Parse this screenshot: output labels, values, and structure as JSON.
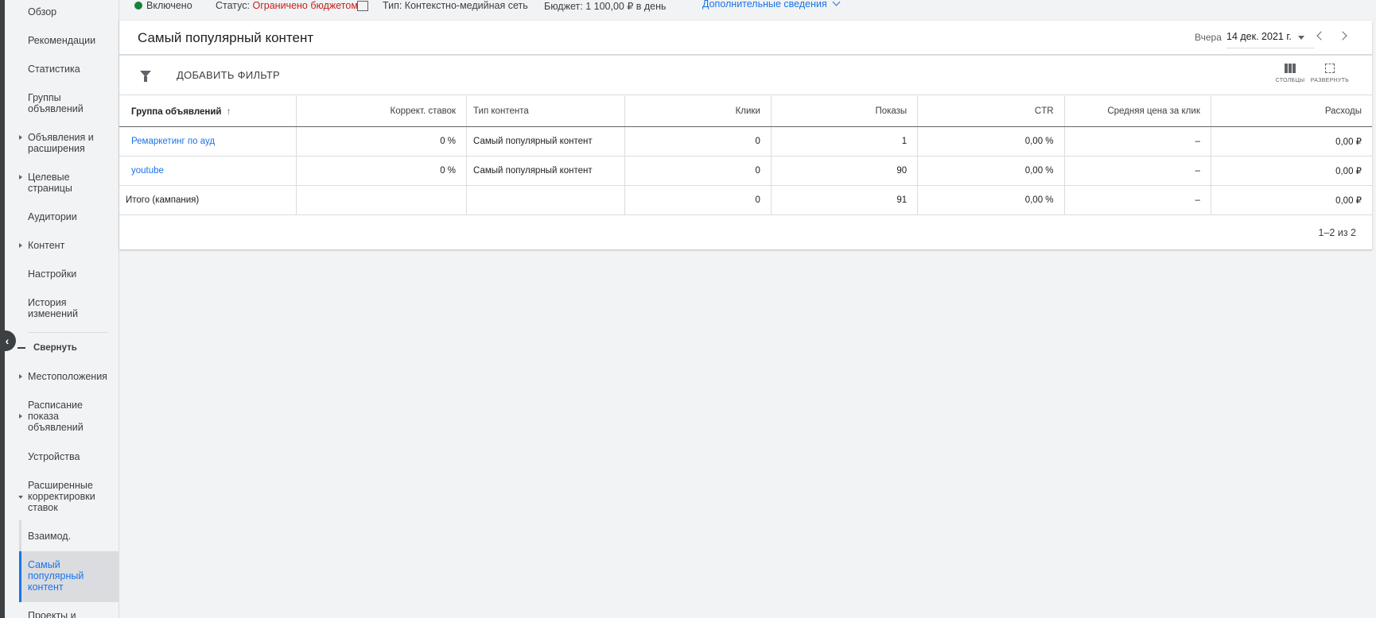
{
  "sidebar": {
    "items": [
      {
        "label": "Обзор"
      },
      {
        "label": "Рекомендации"
      },
      {
        "label": "Статистика"
      },
      {
        "label": "Группы объявлений"
      },
      {
        "label": "Объявления и расширения"
      },
      {
        "label": "Целевые страницы"
      },
      {
        "label": "Аудитории"
      },
      {
        "label": "Контент"
      },
      {
        "label": "Настройки"
      },
      {
        "label": "История изменений"
      },
      {
        "label": "Местоположения"
      },
      {
        "label": "Расписание показа объявлений"
      },
      {
        "label": "Устройства"
      },
      {
        "label": "Расширенные корректировки ставок"
      },
      {
        "label": "Взаимод."
      },
      {
        "label": "Самый популярный контент"
      },
      {
        "label": "Проекты и"
      }
    ],
    "collapse_label": "Свернуть"
  },
  "status": {
    "state": "Включено",
    "status_label": "Статус:",
    "status_value": "Ограничено бюджетом",
    "type_label": "Тип:",
    "type_value": "Контекстно-медийная сеть",
    "budget_label": "Бюджет:",
    "budget_value": "1 100,00 ₽ в день",
    "more": "Дополнительные сведения"
  },
  "card": {
    "title": "Самый популярный контент",
    "date_label": "Вчера",
    "date_value": "14 дек. 2021 г.",
    "add_filter": "ДОБАВИТЬ ФИЛЬТР",
    "columns_label": "СТОЛБЦЫ",
    "expand_label": "РАЗВЕРНУТЬ"
  },
  "table": {
    "headers": [
      "Группа объявлений",
      "Коррект. ставок",
      "Тип контента",
      "Клики",
      "Показы",
      "CTR",
      "Средняя цена за клик",
      "Расходы"
    ],
    "rows": [
      [
        "Ремаркетинг по ауд",
        "0 %",
        "Самый популярный контент",
        "0",
        "1",
        "0,00 %",
        "–",
        "0,00 ₽"
      ],
      [
        "youtube",
        "0 %",
        "Самый популярный контент",
        "0",
        "90",
        "0,00 %",
        "–",
        "0,00 ₽"
      ]
    ],
    "total": [
      "Итого (кампания)",
      "",
      "",
      "0",
      "91",
      "0,00 %",
      "–",
      "0,00 ₽"
    ],
    "pager": "1–2 из 2"
  },
  "colors": {
    "accent": "#1a73e8",
    "status_red": "#c5221f",
    "enabled_green": "#188038"
  }
}
